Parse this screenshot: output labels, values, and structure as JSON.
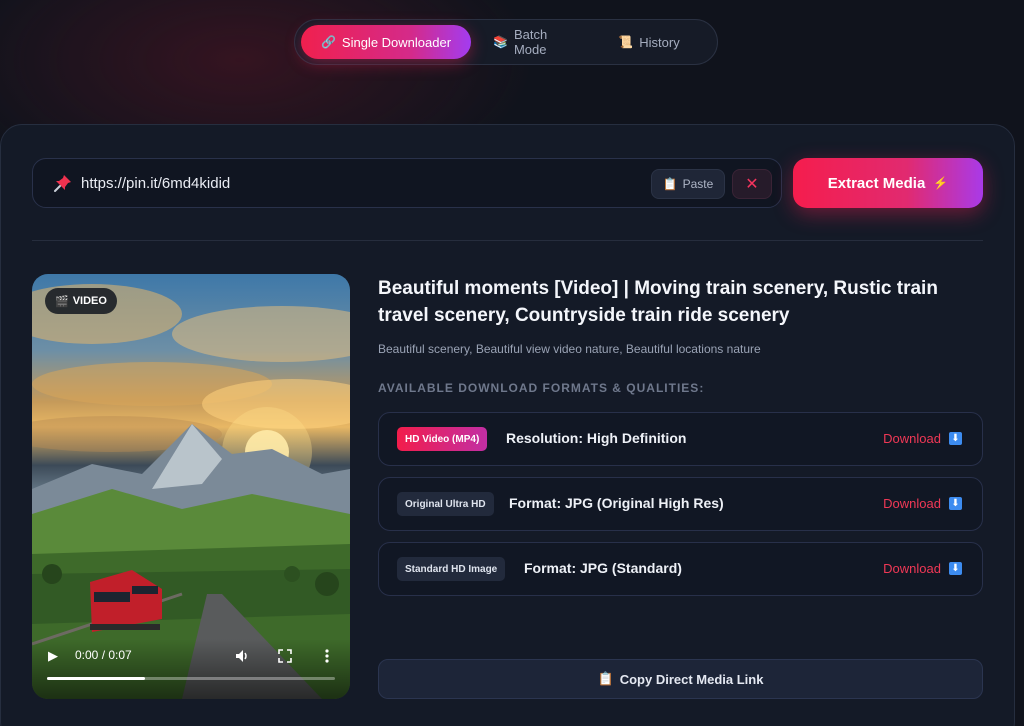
{
  "tabs": [
    {
      "label": "Single Downloader",
      "icon": "link-icon",
      "glyph": "🔗",
      "active": true
    },
    {
      "label": "Batch Mode",
      "icon": "stack-icon",
      "glyph": "📚",
      "active": false
    },
    {
      "label": "History",
      "icon": "scroll-icon",
      "glyph": "📜",
      "active": false
    }
  ],
  "input": {
    "url_value": "https://pin.it/6md4kidid",
    "placeholder": "",
    "paste_label": "Paste",
    "clear_glyph": "✕"
  },
  "extract": {
    "label": "Extract Media",
    "glyph": "⚡"
  },
  "preview": {
    "badge_glyph": "🎬",
    "badge_label": "VIDEO",
    "time": "0:00 / 0:07",
    "progress": 0.34
  },
  "media": {
    "title": "Beautiful moments [Video] | Moving train scenery, Rustic train travel scenery, Countryside train ride scenery",
    "description": "Beautiful scenery, Beautiful view video nature, Beautiful locations nature",
    "formats_heading": "AVAILABLE DOWNLOAD FORMATS & QUALITIES:"
  },
  "formats": [
    {
      "badge": "HD Video (MP4)",
      "label": "Resolution: High Definition",
      "download": "Download"
    },
    {
      "badge": "Original Ultra HD",
      "label": "Format: JPG (Original High Res)",
      "download": "Download"
    },
    {
      "badge": "Standard HD Image",
      "label": "Format: JPG (Standard)",
      "download": "Download"
    }
  ],
  "copy_link": {
    "label": "Copy Direct Media Link",
    "glyph": "📋"
  },
  "colors": {
    "accent": "#f51d4d",
    "accent_purple": "#a93ae8",
    "background": "#10131c",
    "card": "#141a27",
    "download_link": "#f03856"
  }
}
